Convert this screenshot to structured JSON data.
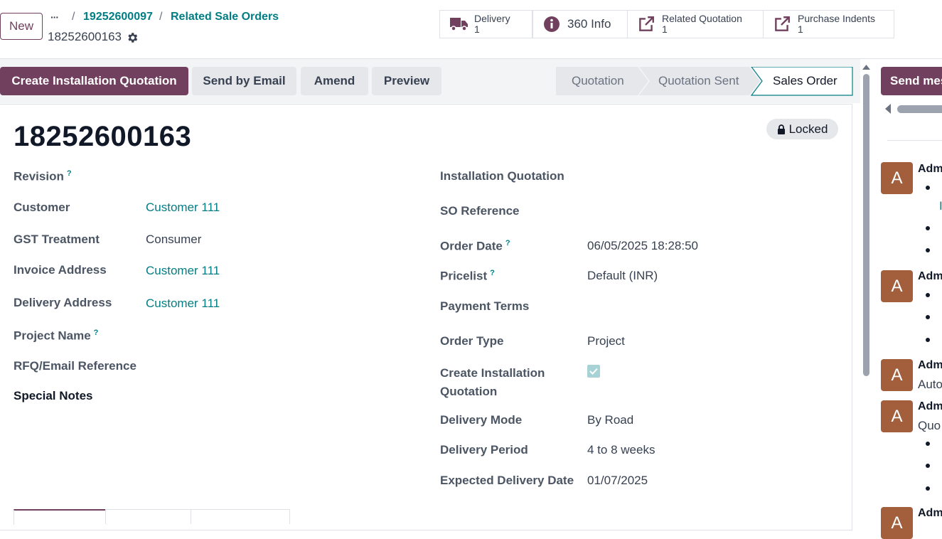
{
  "header": {
    "new_label": "New",
    "breadcrumb": {
      "ellipsis": "···",
      "sep": "/",
      "item1": "19252600097",
      "item2": "Related Sale Orders"
    },
    "record_name": "18252600163"
  },
  "smart_buttons": [
    {
      "label": "Delivery",
      "count": "1",
      "icon": "truck-icon"
    },
    {
      "label": "360 Info",
      "icon": "info-icon"
    },
    {
      "label": "Related Quotation",
      "count": "1",
      "icon": "external-link-icon"
    },
    {
      "label": "Purchase Indents",
      "count": "1",
      "icon": "external-link-icon"
    }
  ],
  "actions": {
    "create_installation": "Create Installation Quotation",
    "send_email": "Send by Email",
    "amend": "Amend",
    "preview": "Preview"
  },
  "statusbar": {
    "steps": [
      "Quotation",
      "Quotation Sent",
      "Sales Order"
    ],
    "active": "Sales Order"
  },
  "form": {
    "title": "18252600163",
    "locked_label": "Locked",
    "left": {
      "revision_label": "Revision",
      "customer_label": "Customer",
      "customer_value": "Customer 111",
      "gst_label": "GST Treatment",
      "gst_value": "Consumer",
      "invoice_label": "Invoice Address",
      "invoice_value": "Customer 111",
      "delivery_label": "Delivery Address",
      "delivery_value": "Customer 111",
      "project_label": "Project Name",
      "rfq_label": "RFQ/Email Reference",
      "notes_label": "Special Notes"
    },
    "right": {
      "install_quot_label": "Installation Quotation",
      "so_ref_label": "SO Reference",
      "order_date_label": "Order Date",
      "order_date_value": "06/05/2025 18:28:50",
      "pricelist_label": "Pricelist",
      "pricelist_value": "Default (INR)",
      "payment_terms_label": "Payment Terms",
      "order_type_label": "Order Type",
      "order_type_value": "Project",
      "create_install_label_1": "Create Installation",
      "create_install_label_2": "Quotation",
      "create_install_checked": true,
      "delivery_mode_label": "Delivery Mode",
      "delivery_mode_value": "By Road",
      "delivery_period_label": "Delivery Period",
      "delivery_period_value": "4 to 8 weeks",
      "expected_date_label": "Expected Delivery Date",
      "expected_date_value": "01/07/2025"
    },
    "help_mark": "?"
  },
  "chatter": {
    "send_message": "Send message",
    "messages": [
      {
        "avatar": "A",
        "author": "Admin",
        "link_fragment": "I"
      },
      {
        "avatar": "A",
        "author": "Admin"
      },
      {
        "avatar": "A",
        "author": "Admin",
        "text": "Auto"
      },
      {
        "avatar": "A",
        "author": "Admin",
        "text": "Quo"
      },
      {
        "avatar": "A",
        "author": "Admin"
      }
    ]
  },
  "colors": {
    "primary": "#71405e",
    "link": "#017e84",
    "avatar": "#a35f3c"
  }
}
